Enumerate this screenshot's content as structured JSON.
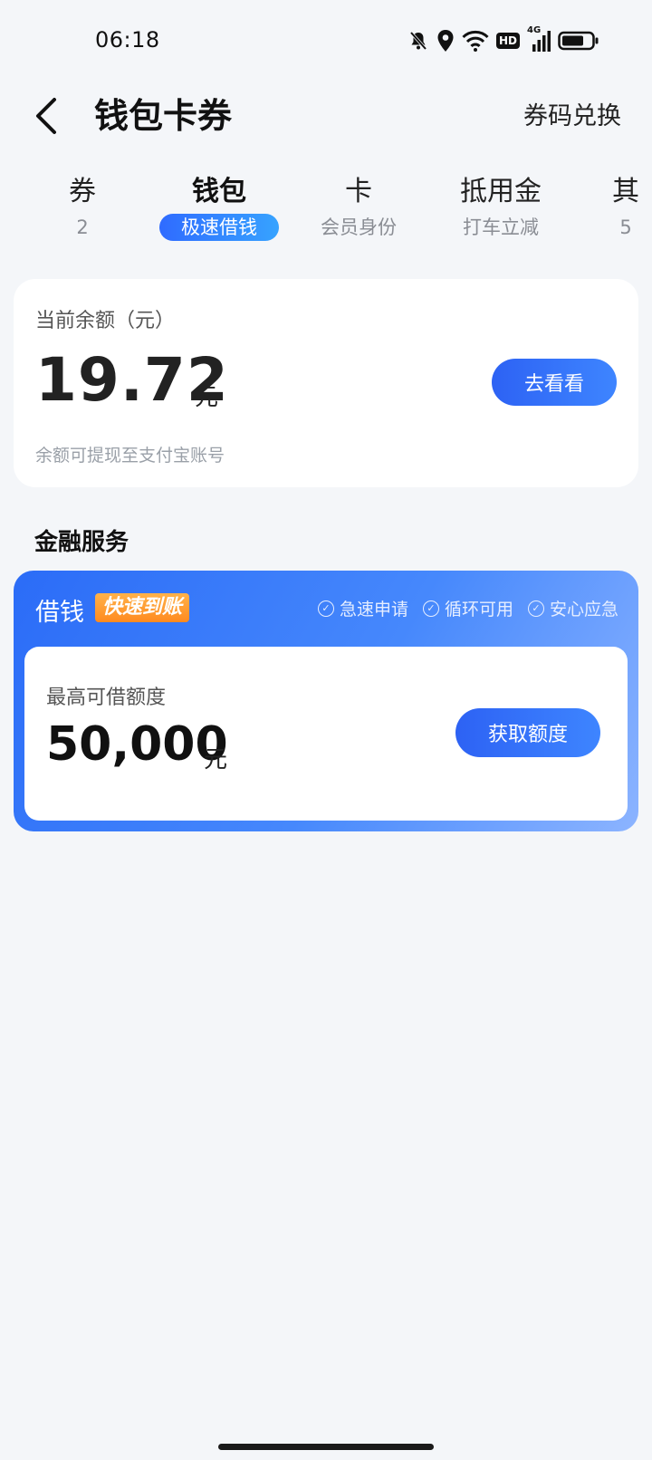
{
  "status_bar": {
    "time": "06:18",
    "network": "4G",
    "hd": "HD"
  },
  "header": {
    "title": "钱包卡券",
    "redeem": "券码兑换"
  },
  "tabs": [
    {
      "title": "券",
      "sub": "2"
    },
    {
      "title": "钱包",
      "sub": "极速借钱"
    },
    {
      "title": "卡",
      "sub": "会员身份"
    },
    {
      "title": "抵用金",
      "sub": "打车立减"
    },
    {
      "title": "其",
      "sub": "5"
    }
  ],
  "balance": {
    "label": "当前余额（元）",
    "amount": "19.72",
    "unit": "元",
    "note": "余额可提现至支付宝账号",
    "button": "去看看"
  },
  "finance": {
    "section_title": "金融服务",
    "loan_title": "借钱",
    "badge": "快速到账",
    "features": [
      "急速申请",
      "循环可用",
      "安心应急"
    ],
    "limit_label": "最高可借额度",
    "limit_amount": "50,000",
    "limit_unit": "元",
    "button": "获取额度"
  },
  "colors": {
    "accent": "#2d62f4",
    "badge": "#ff9a2e",
    "background": "#f4f6f9"
  }
}
